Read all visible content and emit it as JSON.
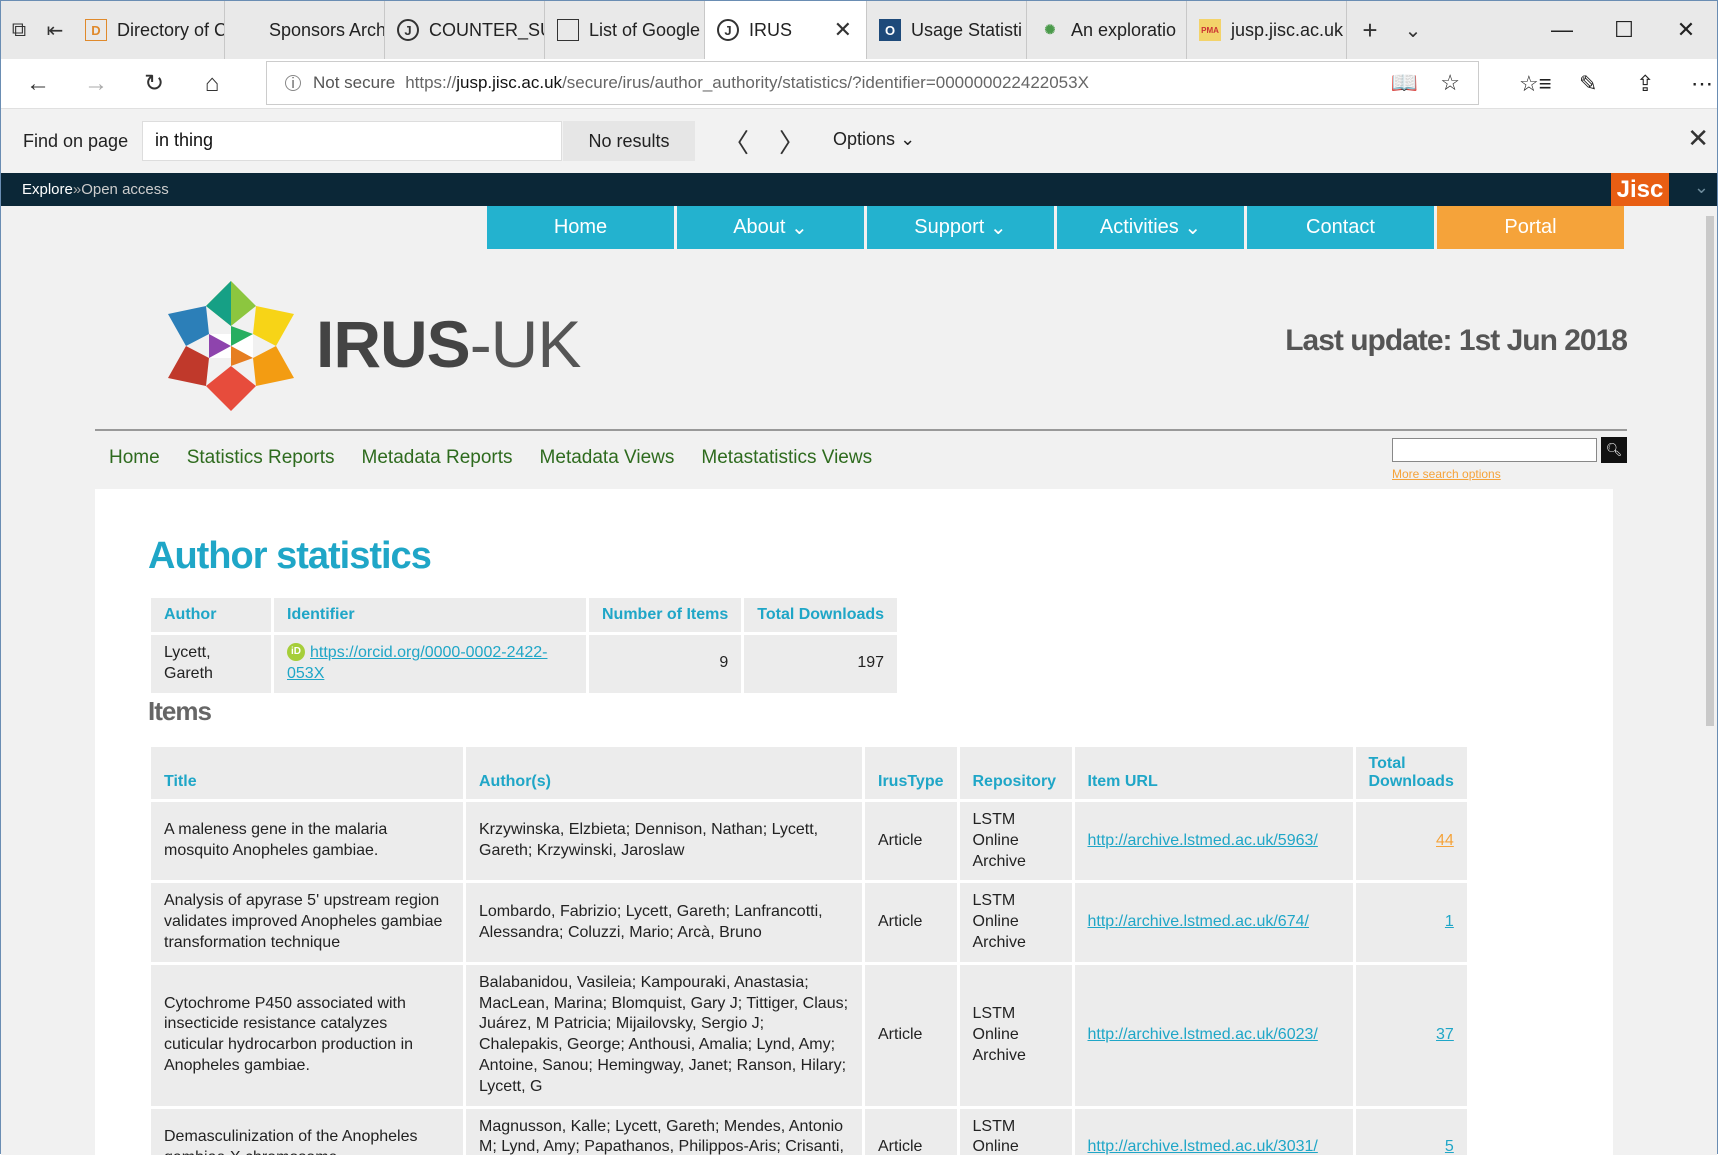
{
  "tabs": [
    {
      "label": "Directory of C",
      "favicon": "D",
      "active": false
    },
    {
      "label": "Sponsors Arch",
      "favicon": "",
      "active": false
    },
    {
      "label": "COUNTER_SU",
      "favicon": "J",
      "active": false
    },
    {
      "label": "List of Google",
      "favicon": "page",
      "active": false
    },
    {
      "label": "IRUS",
      "favicon": "J",
      "active": true
    },
    {
      "label": "Usage Statisti",
      "favicon": "O",
      "active": false
    },
    {
      "label": "An exploratio",
      "favicon": "",
      "active": false
    },
    {
      "label": "jusp.jisc.ac.uk",
      "favicon": "PMA",
      "active": false
    }
  ],
  "address": {
    "not_secure": "Not secure",
    "scheme": "https://",
    "domain": "jusp.jisc.ac.uk",
    "path": "/secure/irus/author_authority/statistics/?identifier=000000022422053X"
  },
  "find": {
    "label": "Find on page",
    "query": "in thing",
    "status": "No results",
    "options": "Options"
  },
  "jisc": {
    "explore": "Explore",
    "sep": " » ",
    "open_access": "Open access",
    "logo": "Jisc"
  },
  "mainnav": [
    "Home",
    "About",
    "Support",
    "Activities",
    "Contact",
    "Portal"
  ],
  "logo": {
    "irus": "IRUS",
    "uk": "-UK"
  },
  "last_update": "Last update: 1st Jun 2018",
  "subnav": [
    "Home",
    "Statistics Reports",
    "Metadata Reports",
    "Metadata Views",
    "Metastatistics Views"
  ],
  "more_search": "More search options",
  "title": "Author statistics",
  "author_table": {
    "headers": [
      "Author",
      "Identifier",
      "Number of Items",
      "Total Downloads"
    ],
    "row": {
      "author": "Lycett, Gareth",
      "identifier": "https://orcid.org/0000-0002-2422-053X",
      "items": "9",
      "downloads": "197"
    }
  },
  "items_heading": "Items",
  "items_table": {
    "headers": [
      "Title",
      "Author(s)",
      "IrusType",
      "Repository",
      "Item URL",
      "Total Downloads"
    ],
    "rows": [
      {
        "title": "A maleness gene in the malaria mosquito Anopheles gambiae.",
        "authors": "Krzywinska, Elzbieta; Dennison, Nathan; Lycett, Gareth; Krzywinski, Jaroslaw",
        "type": "Article",
        "repo": "LSTM Online Archive",
        "url": "http://archive.lstmed.ac.uk/5963/",
        "downloads": "44"
      },
      {
        "title": "Analysis of apyrase 5' upstream region validates improved Anopheles gambiae transformation technique",
        "authors": "Lombardo, Fabrizio; Lycett, Gareth; Lanfrancotti, Alessandra; Coluzzi, Mario; Arcà, Bruno",
        "type": "Article",
        "repo": "LSTM Online Archive",
        "url": "http://archive.lstmed.ac.uk/674/",
        "downloads": "1"
      },
      {
        "title": "Cytochrome P450 associated with insecticide resistance catalyzes cuticular hydrocarbon production in Anopheles gambiae.",
        "authors": "Balabanidou, Vasileia; Kampouraki, Anastasia; MacLean, Marina; Blomquist, Gary J; Tittiger, Claus; Juárez, M Patricia; Mijailovsky, Sergio J; Chalepakis, George; Anthousi, Amalia; Lynd, Amy; Antoine, Sanou; Hemingway, Janet; Ranson, Hilary; Lycett, G",
        "type": "Article",
        "repo": "LSTM Online Archive",
        "url": "http://archive.lstmed.ac.uk/6023/",
        "downloads": "37"
      },
      {
        "title": "Demasculinization of the Anopheles gambiae X chromosome",
        "authors": "Magnusson, Kalle; Lycett, Gareth; Mendes, Antonio M; Lynd, Amy; Papathanos, Philippos-Aris; Crisanti, Andrea; Windbichler, Nikolai",
        "type": "Article",
        "repo": "LSTM Online Archive",
        "url": "http://archive.lstmed.ac.uk/3031/",
        "downloads": "5"
      }
    ]
  },
  "colors": {
    "teal": "#23b2cf",
    "orange": "#f5a33a",
    "jisc_dark": "#0b2737",
    "jisc_orange": "#e85e13"
  }
}
